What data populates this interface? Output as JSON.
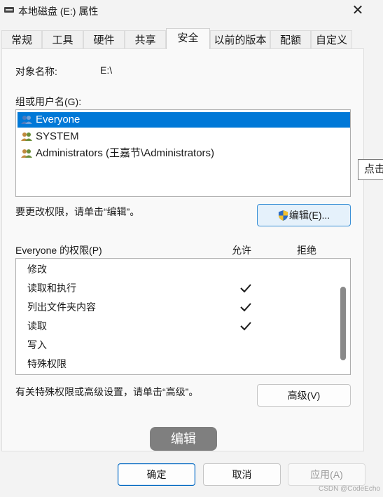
{
  "window": {
    "title": "本地磁盘 (E:) 属性",
    "close_symbol": "✕"
  },
  "tabs": [
    {
      "label": "常规"
    },
    {
      "label": "工具"
    },
    {
      "label": "硬件"
    },
    {
      "label": "共享"
    },
    {
      "label": "安全",
      "active": true
    },
    {
      "label": "以前的版本"
    },
    {
      "label": "配额"
    },
    {
      "label": "自定义"
    }
  ],
  "security": {
    "object_name_label": "对象名称:",
    "object_name_value": "E:\\",
    "group_label": "组或用户名(G):",
    "users": [
      {
        "name": "Everyone",
        "selected": true
      },
      {
        "name": "SYSTEM"
      },
      {
        "name": "Administrators (王嘉节\\Administrators)"
      }
    ],
    "change_perm_text": "要更改权限，请单击“编辑”。",
    "edit_button": "编辑(E)...",
    "perm_header": "Everyone 的权限(P)",
    "allow_label": "允许",
    "deny_label": "拒绝",
    "permissions": [
      {
        "name": "修改",
        "allow": false
      },
      {
        "name": "读取和执行",
        "allow": true
      },
      {
        "name": "列出文件夹内容",
        "allow": true
      },
      {
        "name": "读取",
        "allow": true
      },
      {
        "name": "写入",
        "allow": false
      },
      {
        "name": "特殊权限",
        "allow": false
      }
    ],
    "advanced_text": "有关特殊权限或高级设置，请单击“高级”。",
    "advanced_button": "高级(V)"
  },
  "tooltip": {
    "text": "点击"
  },
  "overlay": {
    "label": "编辑"
  },
  "footer": {
    "ok": "确定",
    "cancel": "取消",
    "apply": "应用(A)"
  },
  "watermark": "CSDN @CodeEcho",
  "colors": {
    "selection": "#0078d7",
    "overlay": "#7f7f7f"
  }
}
